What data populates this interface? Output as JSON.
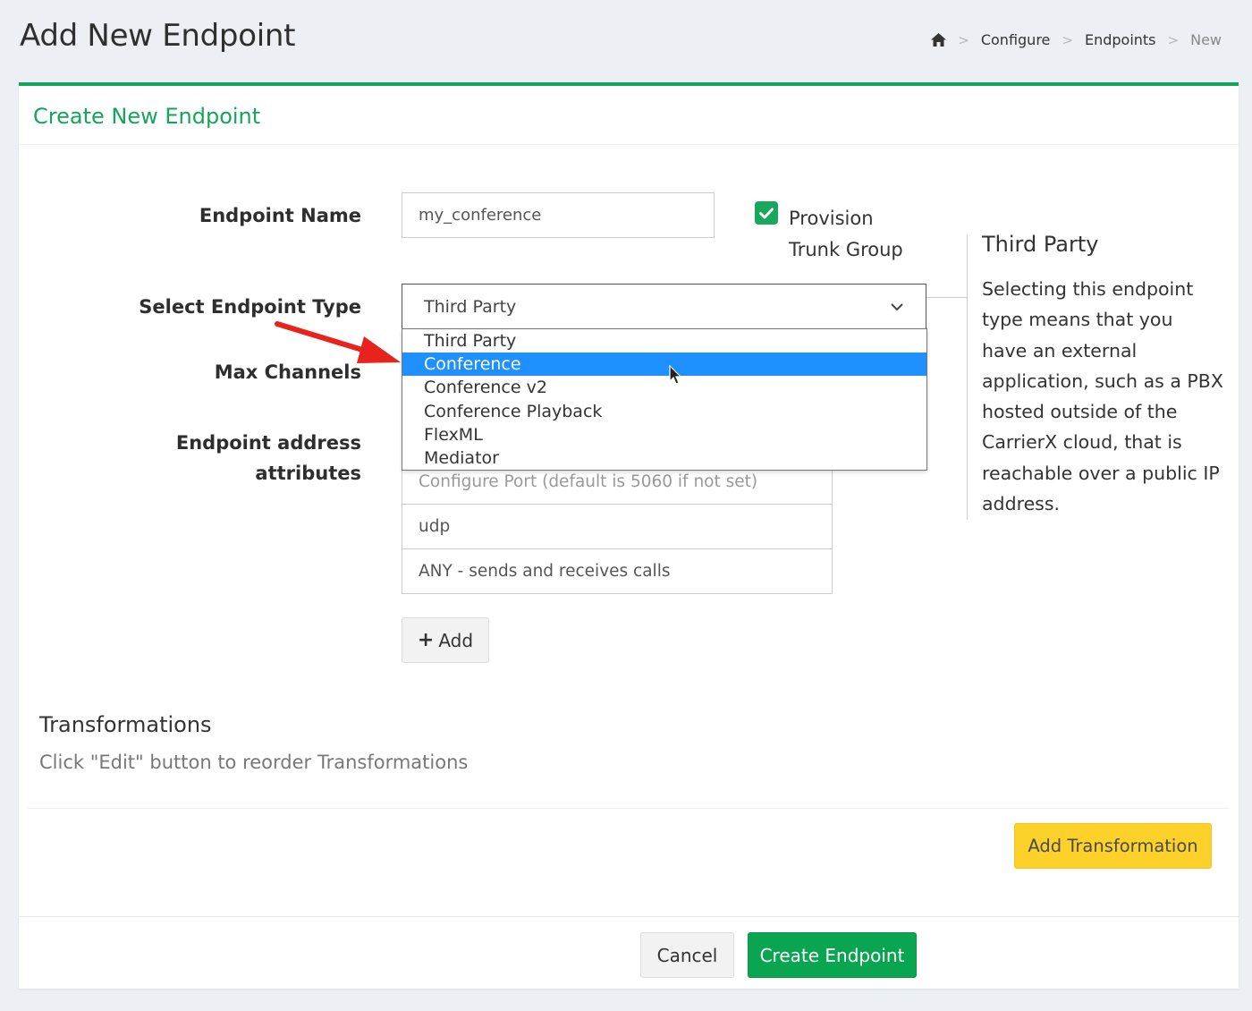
{
  "header": {
    "title": "Add New Endpoint",
    "breadcrumb": [
      {
        "label": "Configure"
      },
      {
        "label": "Endpoints"
      },
      {
        "label": "New"
      }
    ],
    "home_icon": "home-icon"
  },
  "card": {
    "title": "Create New Endpoint"
  },
  "form": {
    "endpoint_name_label": "Endpoint Name",
    "endpoint_name_value": "my_conference",
    "provision_label": "Provision Trunk Group",
    "provision_checked": true,
    "endpoint_type_label": "Select Endpoint Type",
    "endpoint_type_value": "Third Party",
    "max_channels_label": "Max Channels",
    "address_label_line1": "Endpoint address",
    "address_label_line2": "attributes",
    "address_items": [
      {
        "text": "Configure Port (default is 5060 if not set)",
        "placeholder": true
      },
      {
        "text": "udp",
        "placeholder": false
      },
      {
        "text": "ANY - sends and receives calls",
        "placeholder": false
      }
    ],
    "add_button_label": "Add"
  },
  "dropdown": {
    "options": [
      "Third Party",
      "Conference",
      "Conference v2",
      "Conference Playback",
      "FlexML",
      "Mediator"
    ],
    "highlighted": "Conference",
    "highlight_color": "#1e90ff"
  },
  "help": {
    "title": "Third Party",
    "text": "Selecting this endpoint type means that you have an external application, such as a PBX hosted outside of the CarrierX cloud, that is reachable over a public IP address."
  },
  "transformations": {
    "title": "Transformations",
    "hint": "Click \"Edit\" button to reorder Transformations",
    "add_button_label": "Add Transformation"
  },
  "footer": {
    "cancel_label": "Cancel",
    "create_label": "Create Endpoint"
  },
  "colors": {
    "accent_green": "#0fa75b",
    "warning_yellow": "#fcd12a",
    "annotation_red": "#e8231e"
  }
}
